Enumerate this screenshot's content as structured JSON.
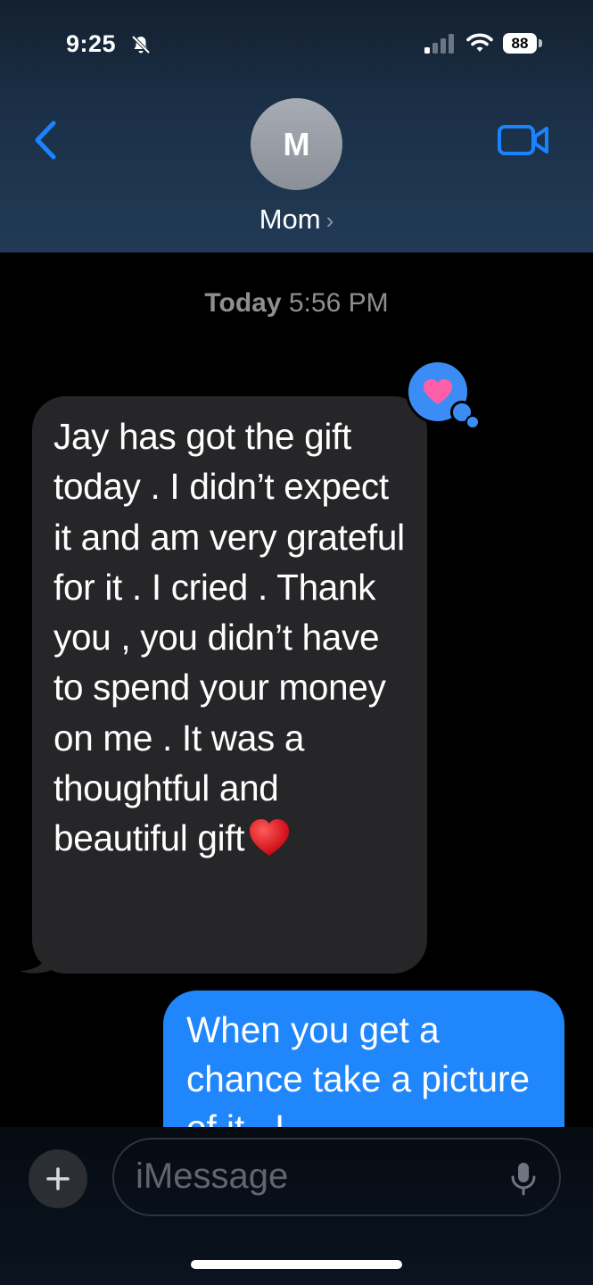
{
  "status_bar": {
    "time": "9:25",
    "battery_level": "88",
    "silent_icon": "bell-slash-icon",
    "signal_icon": "cellular-signal-icon",
    "wifi_icon": "wifi-icon"
  },
  "header": {
    "back_icon": "chevron-left-icon",
    "avatar_initial": "M",
    "contact_name": "Mom",
    "contact_chevron": "›",
    "video_icon": "video-camera-icon"
  },
  "conversation": {
    "timestamp_day": "Today",
    "timestamp_time": "5:56 PM",
    "messages": [
      {
        "direction": "incoming",
        "text": "Jay has got the gift today . I didn’t expect it and am very grateful for it . I cried . Thank you , you didn’t have to spend your money on me . It was a thoughtful and beautiful gift",
        "emoji": "red-heart",
        "tapback": "heart"
      },
      {
        "direction": "outgoing",
        "text": "When you get a chance take a picture of it . I"
      }
    ]
  },
  "composer": {
    "plus_label": "+",
    "placeholder": "iMessage",
    "mic_icon": "microphone-icon"
  },
  "colors": {
    "incoming_bubble": "#262628",
    "outgoing_bubble": "#1f86fb",
    "accent_blue": "#1a84ff",
    "tapback_heart": "#ff5fa8"
  }
}
